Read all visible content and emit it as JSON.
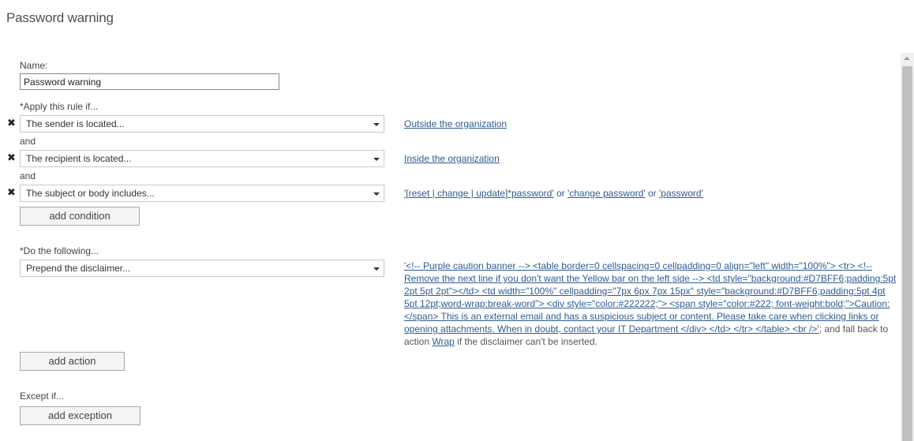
{
  "page": {
    "title": "Password warning"
  },
  "form": {
    "name_label": "Name:",
    "name_value": "Password warning",
    "apply_label": "*Apply this rule if...",
    "conditions": [
      {
        "select": "The sender is located...",
        "value": "Outside the organization"
      },
      {
        "connector": "and",
        "select": "The recipient is located...",
        "value": "Inside the organization"
      },
      {
        "connector": "and",
        "select": "The subject or body includes...",
        "value_parts": [
          "'[reset | change | update]*password'",
          " or ",
          "'change password'",
          " or ",
          "'password'"
        ]
      }
    ],
    "add_condition_label": "add condition",
    "do_label": "*Do the following...",
    "action": {
      "select": "Prepend the disclaimer...",
      "disclaimer_link": "'<!-- Purple caution banner --> <table border=0 cellspacing=0 cellpadding=0 align=\"left\" width=\"100%\"> <tr> <!-- Remove the next line if you don't want the Yellow bar on the left side --> <td style=\"background:#D7BFF6;padding:5pt 2pt 5pt 2pt\"></td> <td width=\"100%\" cellpadding=\"7px 6px 7px 15px\" style=\"background:#D7BFF6;padding:5pt 4pt 5pt 12pt;word-wrap:break-word\"> <div style=\"color:#222222;\"> <span style=\"color:#222; font-weight:bold;\">Caution:</span> This is an external email and has a suspicious subject or content. Please take care when clicking links or opening attachments. When in doubt, contact your IT Department </div> </td> </tr> </table> <br />'",
      "fallback_prefix": "; and fall back to action ",
      "fallback_link": "Wrap",
      "fallback_suffix": " if the disclaimer can't be inserted."
    },
    "add_action_label": "add action",
    "except_label": "Except if...",
    "add_exception_label": "add exception"
  },
  "icons": {
    "remove": "✖"
  },
  "colors": {
    "link": "#2f5b8f",
    "scroll_thumb": "#c0c0c0"
  }
}
